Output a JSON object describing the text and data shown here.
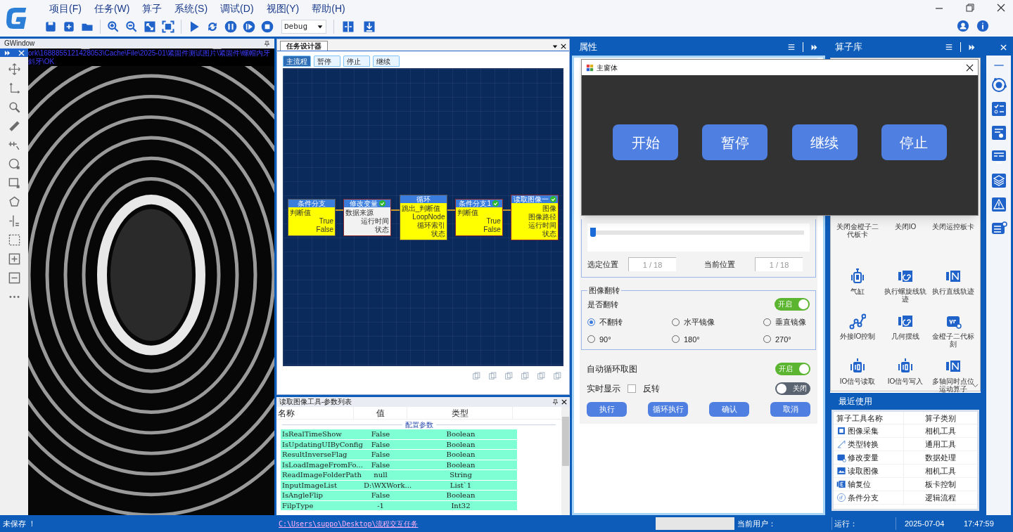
{
  "menu": [
    "项目(F)",
    "任务(W)",
    "算子",
    "系统(S)",
    "调试(D)",
    "视图(Y)",
    "帮助(H)"
  ],
  "toolbar": {
    "mode": "Debug"
  },
  "image_window": {
    "title": "GWindow",
    "path_text": "ork\\1688855121428053\\Cache\\File\\2025-01\\紧固件测试图片\\紧固件\\螺帽内牙斜牙\\OK"
  },
  "task_designer": {
    "title": "任务设计器",
    "tabs": [
      {
        "label": "主流程",
        "selected": true
      },
      {
        "label": "暂停",
        "selected": false
      },
      {
        "label": "停止",
        "selected": false
      },
      {
        "label": "继续",
        "selected": false
      }
    ],
    "nodes": [
      {
        "title": "条件分支",
        "kind": "branch",
        "passed": false,
        "inputs": [
          "判断值"
        ],
        "outputs": [
          "True",
          "False"
        ]
      },
      {
        "title": "修改变量",
        "kind": "variable",
        "passed": true,
        "inputs": [
          "数据来源"
        ],
        "outputs": [
          "运行时间",
          "状态"
        ]
      },
      {
        "title": "循环",
        "kind": "loop",
        "passed": false,
        "inputs": [
          "跳出_判断值"
        ],
        "outputs": [
          "LoopNode",
          "循环索引",
          "状态"
        ]
      },
      {
        "title": "条件分支1",
        "kind": "branch",
        "passed": true,
        "inputs": [
          "判断值"
        ],
        "outputs": [
          "True",
          "False"
        ]
      },
      {
        "title": "读取图像一",
        "kind": "image",
        "passed": true,
        "outputs": [
          "图像",
          "图像路径",
          "运行时间",
          "状态"
        ]
      }
    ]
  },
  "param_list": {
    "title": "读取图像工具-参数列表",
    "columns": [
      "名称",
      "值",
      "类型"
    ],
    "group": "配置参数",
    "rows": [
      {
        "name": "IsRealTimeShow",
        "value": "False",
        "type": "Boolean"
      },
      {
        "name": "IsUpdatingUIByConfig",
        "value": "False",
        "type": "Boolean"
      },
      {
        "name": "ResultInverseFlag",
        "value": "False",
        "type": "Boolean"
      },
      {
        "name": "IsLoadImageFromFo...",
        "value": "False",
        "type": "Boolean"
      },
      {
        "name": "ReadImageFolderPath",
        "value": "null",
        "type": "String"
      },
      {
        "name": "InputImageList",
        "value": "D:\\WXWork...",
        "type": "List`1"
      },
      {
        "name": "IsAngleFlip",
        "value": "False",
        "type": "Boolean"
      },
      {
        "name": "FilpType",
        "value": "-1",
        "type": "Int32"
      }
    ]
  },
  "properties": {
    "title": "属性",
    "slider": {
      "level": 0
    },
    "selected_position_label": "选定位置",
    "selected_position": "1 / 18",
    "current_position_label": "当前位置",
    "current_position": "1 / 18",
    "flip": {
      "title": "图像翻转",
      "label": "是否翻转",
      "on": true,
      "toggle_label": "开启",
      "options": [
        {
          "label": "不翻转",
          "selected": true
        },
        {
          "label": "水平镜像",
          "selected": false
        },
        {
          "label": "垂直镜像",
          "selected": false
        },
        {
          "label": "90°",
          "selected": false
        },
        {
          "label": "180°",
          "selected": false
        },
        {
          "label": "270°",
          "selected": false
        }
      ]
    },
    "auto_loop": {
      "label": "自动循环取图",
      "on": true,
      "toggle_label": "开启"
    },
    "realtime": {
      "label": "实时显示",
      "checkbox_label": "反转",
      "checked": false,
      "on": false,
      "toggle_label": "关闭"
    },
    "buttons": [
      "执行",
      "循环执行",
      "确认",
      "取消"
    ]
  },
  "dialog": {
    "title": "主窗体",
    "buttons": [
      "开始",
      "暂停",
      "继续",
      "停止"
    ]
  },
  "operator_library": {
    "title": "算子库",
    "items": [
      {
        "label": "关闭金橙子二代板卡",
        "kind": "card"
      },
      {
        "label": "关闭IO",
        "kind": "card"
      },
      {
        "label": "关闭运控板卡",
        "kind": "card"
      },
      {
        "label": "气缸",
        "kind": "cylinder"
      },
      {
        "label": "执行螺旋线轨迹",
        "kind": "spiral"
      },
      {
        "label": "执行直线轨迹",
        "kind": "line"
      },
      {
        "label": "外接IO控制",
        "kind": "nodes"
      },
      {
        "label": "几何摆线",
        "kind": "spiral"
      },
      {
        "label": "金橙子二代标刻",
        "kind": "var"
      },
      {
        "label": "IO信号读取",
        "kind": "io"
      },
      {
        "label": "IO信号写入",
        "kind": "io"
      },
      {
        "label": "多轴同时点位运动算子",
        "kind": "line"
      }
    ]
  },
  "recent": {
    "title": "最近使用",
    "columns": [
      "算子工具名称",
      "算子类别"
    ],
    "rows": [
      {
        "name": "图像采集",
        "category": "相机工具",
        "kind": "chip"
      },
      {
        "name": "类型转换",
        "category": "通用工具",
        "kind": "convert"
      },
      {
        "name": "修改变量",
        "category": "数据处理",
        "kind": "var"
      },
      {
        "name": "读取图像",
        "category": "相机工具",
        "kind": "image"
      },
      {
        "name": "轴复位",
        "category": "板卡控制",
        "kind": "axis"
      },
      {
        "name": "条件分支",
        "category": "逻辑流程",
        "kind": "if"
      }
    ]
  },
  "status_bar": {
    "save_state": "未保存 ！",
    "path": "C:\\Users\\suppo\\Desktop\\流程交互任务",
    "user_label": "当前用户：",
    "run_label": "运行：",
    "date": "2025-07-04",
    "time": "17:47:59"
  }
}
